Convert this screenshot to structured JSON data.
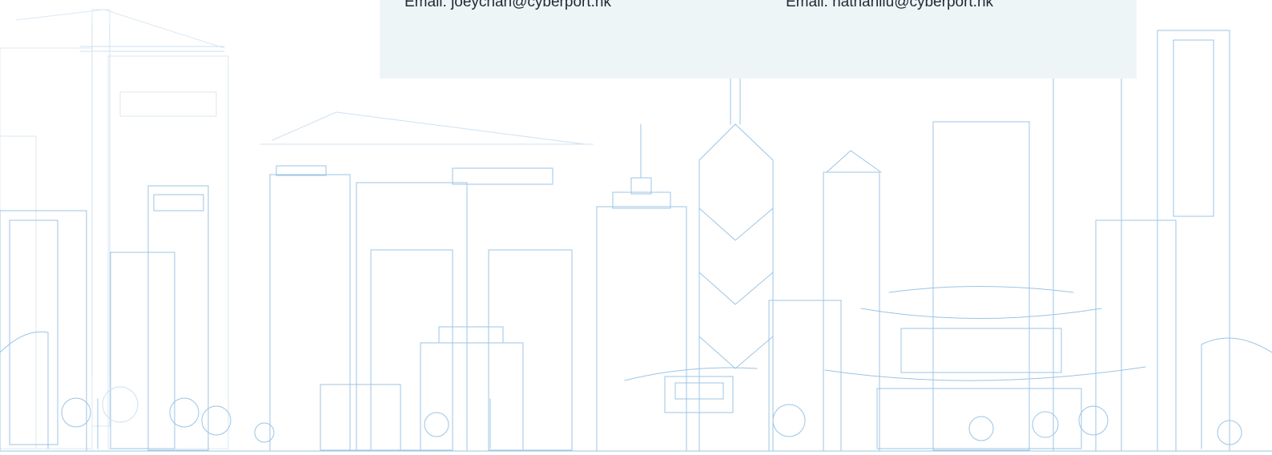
{
  "contacts": [
    {
      "email_text": "Email: joeychan@cyberport.hk"
    },
    {
      "email_text": "Email: nathanliu@cyberport.hk"
    }
  ],
  "colors": {
    "panel_background": "#eef5f7",
    "skyline_line": "#9cc4e4",
    "skyline_line_light": "#cfe1ef",
    "text": "#1f2a33"
  }
}
